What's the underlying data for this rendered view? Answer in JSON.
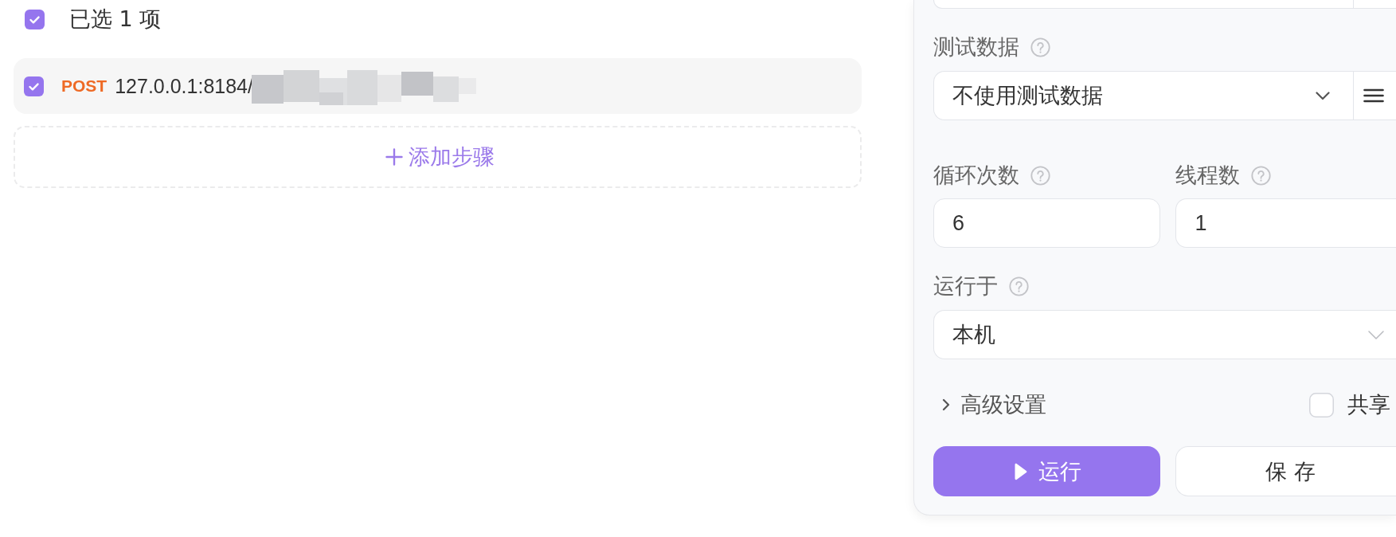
{
  "selection": {
    "checked": true,
    "label": "已选 1 项"
  },
  "steps": [
    {
      "checked": true,
      "method": "POST",
      "url": "127.0.0.1:8184/",
      "redacted": true
    }
  ],
  "add_step": {
    "label": "添加步骤"
  },
  "panel": {
    "top_field": {
      "addon": true
    },
    "fields": [
      {
        "kind": "select",
        "label": "测试数据",
        "help": true,
        "value": "不使用测试数据",
        "addon": true
      },
      {
        "kind": "pair",
        "items": [
          {
            "label": "循环次数",
            "help": true,
            "value": "6"
          },
          {
            "label": "线程数",
            "help": true,
            "value": "1"
          }
        ]
      },
      {
        "kind": "select",
        "label": "运行于",
        "help": true,
        "value": "本机",
        "addon": false
      }
    ],
    "advanced": {
      "label": "高级设置",
      "expanded": false
    },
    "share": {
      "label": "共享",
      "checked": false
    },
    "buttons": [
      {
        "kind": "primary",
        "label": "运行"
      },
      {
        "kind": "default",
        "label": "保 存"
      }
    ]
  }
}
